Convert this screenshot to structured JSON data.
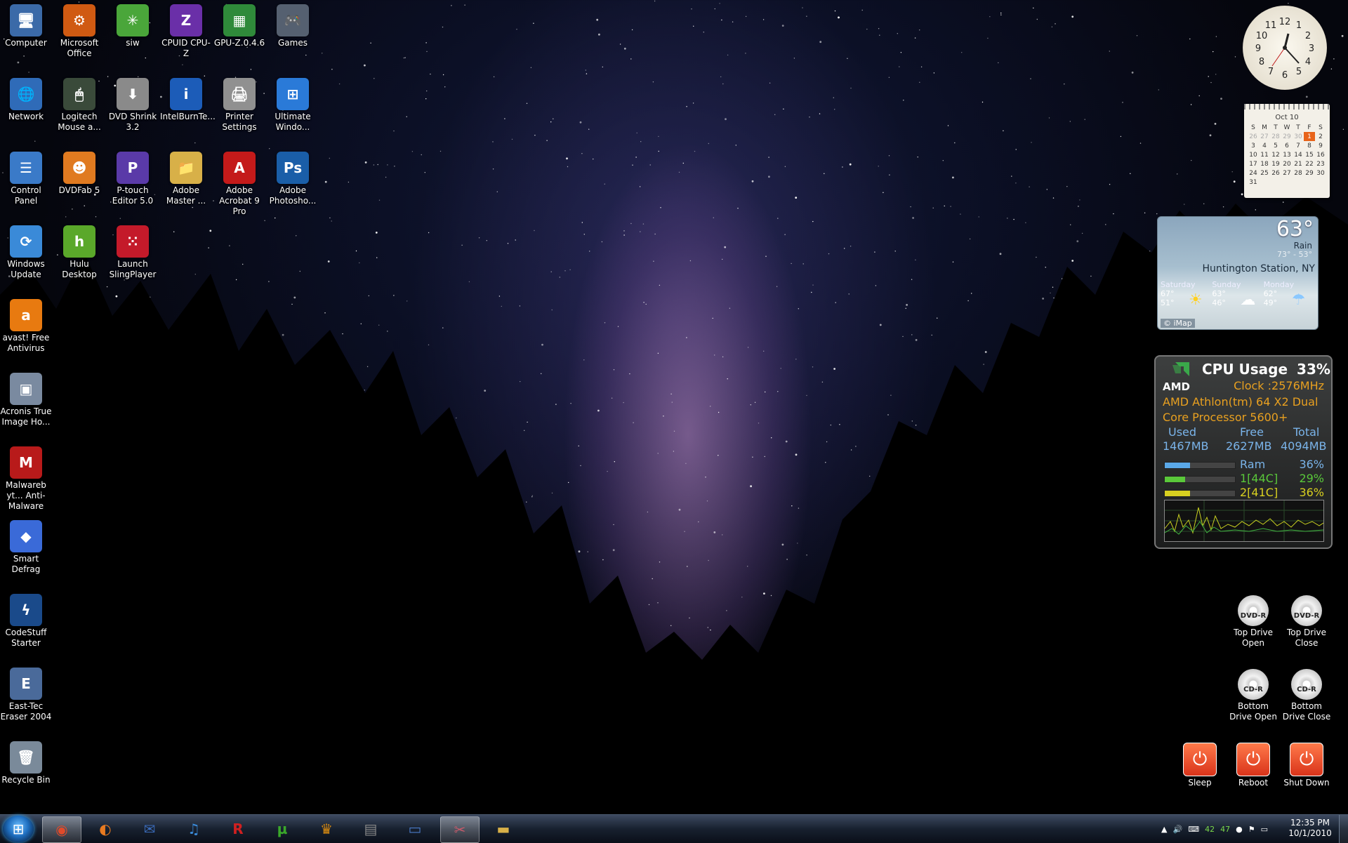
{
  "desktop_icons": [
    {
      "label": "Computer",
      "icon": "computer-icon",
      "glyph": "🖥",
      "color": "#3b6aa8"
    },
    {
      "label": "Microsoft Office",
      "icon": "office-icon",
      "glyph": "⚙",
      "color": "#d05a12"
    },
    {
      "label": "siw",
      "icon": "siw-icon",
      "glyph": "✳",
      "color": "#4aa63a"
    },
    {
      "label": "CPUID CPU-Z",
      "icon": "cpuz-icon",
      "glyph": "Z",
      "color": "#6a2fa8"
    },
    {
      "label": "GPU-Z.0.4.6",
      "icon": "gpuz-icon",
      "glyph": "▦",
      "color": "#2f8a3a"
    },
    {
      "label": "Games",
      "icon": "games-icon",
      "glyph": "🎮",
      "color": "#556070"
    },
    {
      "label": "Network",
      "icon": "network-icon",
      "glyph": "🌐",
      "color": "#2f6bb8"
    },
    {
      "label": "Logitech Mouse a...",
      "icon": "mouse-icon",
      "glyph": "🖱",
      "color": "#3a4a3a"
    },
    {
      "label": "DVD Shrink 3.2",
      "icon": "dvd-shrink-icon",
      "glyph": "⬇",
      "color": "#8a8a8a"
    },
    {
      "label": "IntelBurnTe...",
      "icon": "intel-icon",
      "glyph": "i",
      "color": "#1c5cb8"
    },
    {
      "label": "Printer Settings",
      "icon": "printer-icon",
      "glyph": "🖨",
      "color": "#909090"
    },
    {
      "label": "Ultimate Windo...",
      "icon": "windows-icon",
      "glyph": "⊞",
      "color": "#2a7ad8"
    },
    {
      "label": "Control Panel",
      "icon": "control-panel-icon",
      "glyph": "☰",
      "color": "#3a7ac8"
    },
    {
      "label": "DVDFab 5",
      "icon": "dvdfab-icon",
      "glyph": "☻",
      "color": "#e07a20"
    },
    {
      "label": "P-touch Editor 5.0",
      "icon": "ptouch-icon",
      "glyph": "P",
      "color": "#5a3aa8"
    },
    {
      "label": "Adobe Master ...",
      "icon": "folder-icon",
      "glyph": "📁",
      "color": "#d8b048"
    },
    {
      "label": "Adobe Acrobat 9 Pro",
      "icon": "acrobat-icon",
      "glyph": "A",
      "color": "#c41a1a"
    },
    {
      "label": "Adobe Photosho...",
      "icon": "photoshop-icon",
      "glyph": "Ps",
      "color": "#1a5ea8"
    },
    {
      "label": "Windows Update",
      "icon": "windows-update-icon",
      "glyph": "⟳",
      "color": "#3a8ad8"
    },
    {
      "label": "Hulu Desktop",
      "icon": "hulu-icon",
      "glyph": "h",
      "color": "#5aa82a"
    },
    {
      "label": "Launch SlingPlayer",
      "icon": "slingplayer-icon",
      "glyph": "⁙",
      "color": "#c41a2a"
    },
    {
      "label": "avast! Free Antivirus",
      "icon": "avast-icon",
      "glyph": "a",
      "color": "#e87a10"
    },
    {
      "label": "Acronis True Image Ho...",
      "icon": "acronis-icon",
      "glyph": "▣",
      "color": "#7a8aa0"
    },
    {
      "label": "Malwareb yt... Anti-Malware",
      "icon": "malwarebytes-icon",
      "glyph": "M",
      "color": "#b81a1a"
    },
    {
      "label": "Smart Defrag",
      "icon": "smart-defrag-icon",
      "glyph": "◆",
      "color": "#3a6ad8"
    },
    {
      "label": "CodeStuff Starter",
      "icon": "codestuff-icon",
      "glyph": "ϟ",
      "color": "#1a4a8a"
    },
    {
      "label": "East-Tec Eraser 2004",
      "icon": "eraser-icon",
      "glyph": "E",
      "color": "#4a6a9a"
    },
    {
      "label": "Recycle Bin",
      "icon": "recycle-bin-icon",
      "glyph": "🗑",
      "color": "#7a8a9a"
    }
  ],
  "right_icons": [
    {
      "label": "Top Drive Open",
      "icon": "dvd-drive-icon",
      "badge": "DVD-R"
    },
    {
      "label": "Top Drive Close",
      "icon": "dvd-drive-icon",
      "badge": "DVD-R"
    },
    {
      "label": "Bottom Drive Open",
      "icon": "cd-drive-icon",
      "badge": "CD-R"
    },
    {
      "label": "Bottom Drive Close",
      "icon": "cd-drive-icon",
      "badge": "CD-R"
    },
    {
      "label": "Sleep",
      "icon": "power-icon"
    },
    {
      "label": "Reboot",
      "icon": "power-icon"
    },
    {
      "label": "Shut Down",
      "icon": "power-icon"
    }
  ],
  "calendar": {
    "month": "Oct 10",
    "weekdays": [
      "S",
      "M",
      "T",
      "W",
      "T",
      "F",
      "S"
    ],
    "weeks": [
      [
        "26",
        "27",
        "28",
        "29",
        "30",
        "1",
        "2"
      ],
      [
        "3",
        "4",
        "5",
        "6",
        "7",
        "8",
        "9"
      ],
      [
        "10",
        "11",
        "12",
        "13",
        "14",
        "15",
        "16"
      ],
      [
        "17",
        "18",
        "19",
        "20",
        "21",
        "22",
        "23"
      ],
      [
        "24",
        "25",
        "26",
        "27",
        "28",
        "29",
        "30"
      ],
      [
        "31",
        "",
        "",
        "",
        "",
        "",
        ""
      ]
    ],
    "today": "1"
  },
  "weather": {
    "temp": "63°",
    "condition": "Rain",
    "hilo": "73° - 53°",
    "city": "Huntington Station, NY",
    "forecast": [
      {
        "day": "Saturday",
        "high": "67°",
        "low": "51°",
        "icon": "sun-icon"
      },
      {
        "day": "Sunday",
        "high": "63°",
        "low": "46°",
        "icon": "cloud-icon"
      },
      {
        "day": "Monday",
        "high": "62°",
        "low": "49°",
        "icon": "rain-icon"
      }
    ],
    "credit": "© iMap"
  },
  "cpu_meter": {
    "title": "CPU Usage",
    "usage": "33%",
    "brand": "AMD",
    "clock": "Clock :2576MHz",
    "processor": "AMD Athlon(tm) 64 X2 Dual Core Processor 5600+",
    "mem_headers": [
      "Used",
      "Free",
      "Total"
    ],
    "mem_values": [
      "1467MB",
      "2627MB",
      "4094MB"
    ],
    "rows": [
      {
        "label": "Ram",
        "value": "36%",
        "fill": 0.36,
        "color": "#5aa8e8"
      },
      {
        "label": "1[44C]",
        "value": "29%",
        "fill": 0.29,
        "color": "#5ac83a"
      },
      {
        "label": "2[41C]",
        "value": "36%",
        "fill": 0.36,
        "color": "#d8d020"
      }
    ]
  },
  "taskbar": {
    "apps": [
      {
        "name": "chrome",
        "glyph": "◉",
        "color": "#e04a2a",
        "active": true
      },
      {
        "name": "firefox",
        "glyph": "◐",
        "color": "#e87a20",
        "active": false
      },
      {
        "name": "thunderbird",
        "glyph": "✉",
        "color": "#3a6ab8",
        "active": false
      },
      {
        "name": "itunes",
        "glyph": "♫",
        "color": "#3a8ad8",
        "active": false
      },
      {
        "name": "r-app",
        "glyph": "R",
        "color": "#d02020",
        "active": false
      },
      {
        "name": "utorrent",
        "glyph": "µ",
        "color": "#3aa82a",
        "active": false
      },
      {
        "name": "crown-app",
        "glyph": "♛",
        "color": "#d88a10",
        "active": false
      },
      {
        "name": "snipping",
        "glyph": "▤",
        "color": "#8a8a8a",
        "active": false
      },
      {
        "name": "monitor-app",
        "glyph": "▭",
        "color": "#4a7ac8",
        "active": false
      },
      {
        "name": "scissors-app",
        "glyph": "✂",
        "color": "#c85a6a",
        "active": true
      },
      {
        "name": "explorer",
        "glyph": "▬",
        "color": "#d8b048",
        "active": false
      }
    ],
    "tray": [
      "▲",
      "🔊",
      "⌨",
      "42",
      "47",
      "●",
      "⚑",
      "▭"
    ],
    "time": "12:35 PM",
    "date": "10/1/2010"
  }
}
